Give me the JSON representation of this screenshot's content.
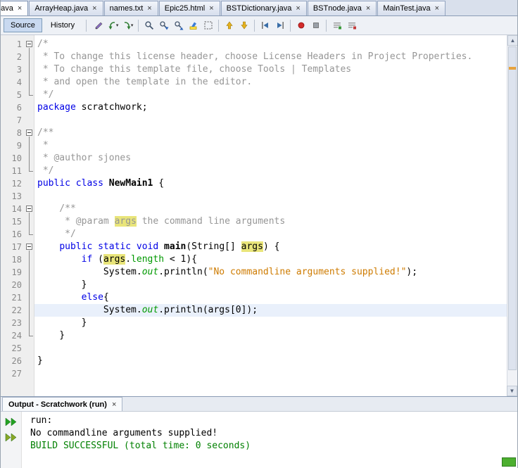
{
  "tab_bar": {
    "tabs": [
      {
        "label": "...ava",
        "active": true,
        "partial": true
      },
      {
        "label": "ArrayHeap.java"
      },
      {
        "label": "names.txt"
      },
      {
        "label": "Epic25.html"
      },
      {
        "label": "BSTDictionary.java"
      },
      {
        "label": "BSTnode.java"
      },
      {
        "label": "MainTest.java"
      }
    ],
    "close_glyph": "×"
  },
  "toolbar": {
    "source_label": "Source",
    "history_label": "History",
    "icon_groups": [
      [
        {
          "name": "last-edit-location"
        },
        {
          "name": "back",
          "dropdown": true
        },
        {
          "name": "forward",
          "dropdown": true
        }
      ],
      [
        {
          "name": "find-selection"
        },
        {
          "name": "find-next-occurrence"
        },
        {
          "name": "find-previous-occurrence"
        },
        {
          "name": "toggle-highlight-search"
        },
        {
          "name": "select-in-projects"
        }
      ],
      [
        {
          "name": "previous-bookmark"
        },
        {
          "name": "next-bookmark"
        }
      ],
      [
        {
          "name": "shift-line-left"
        },
        {
          "name": "shift-line-right"
        }
      ],
      [
        {
          "name": "start-macro-recording"
        },
        {
          "name": "stop-macro-recording"
        }
      ],
      [
        {
          "name": "comment"
        },
        {
          "name": "uncomment"
        }
      ]
    ]
  },
  "editor": {
    "colors": {
      "keyword": "#0000e6",
      "comment": "#969696",
      "string": "#ce7b00",
      "field": "#009900",
      "occurrence_bg": "#e9e57a",
      "current_line_bg": "#e9f0fb"
    },
    "lines": [
      {
        "n": 1,
        "fold": "start",
        "segs": [
          {
            "t": "/*",
            "c": "cm"
          }
        ]
      },
      {
        "n": 2,
        "fold": "mid",
        "segs": [
          {
            "t": " * To change this license header, choose License Headers in Project Properties.",
            "c": "cm"
          }
        ]
      },
      {
        "n": 3,
        "fold": "mid",
        "segs": [
          {
            "t": " * To change this template file, choose Tools | Templates",
            "c": "cm"
          }
        ]
      },
      {
        "n": 4,
        "fold": "mid",
        "segs": [
          {
            "t": " * and open the template in the editor.",
            "c": "cm"
          }
        ]
      },
      {
        "n": 5,
        "fold": "end",
        "segs": [
          {
            "t": " */",
            "c": "cm"
          }
        ]
      },
      {
        "n": 6,
        "fold": "",
        "segs": [
          {
            "t": "package",
            "c": "kw"
          },
          {
            "t": " scratchwork;",
            "c": "pl"
          }
        ]
      },
      {
        "n": 7,
        "fold": "",
        "segs": []
      },
      {
        "n": 8,
        "fold": "start",
        "segs": [
          {
            "t": "/**",
            "c": "cm"
          }
        ]
      },
      {
        "n": 9,
        "fold": "mid",
        "segs": [
          {
            "t": " *",
            "c": "cm"
          }
        ]
      },
      {
        "n": 10,
        "fold": "mid",
        "segs": [
          {
            "t": " * @author sjones",
            "c": "cm"
          }
        ]
      },
      {
        "n": 11,
        "fold": "end",
        "segs": [
          {
            "t": " */",
            "c": "cm"
          }
        ]
      },
      {
        "n": 12,
        "fold": "",
        "segs": [
          {
            "t": "public",
            "c": "kw"
          },
          {
            "t": " ",
            "c": "pl"
          },
          {
            "t": "class",
            "c": "kw"
          },
          {
            "t": " ",
            "c": "pl"
          },
          {
            "t": "NewMain1",
            "c": "cl"
          },
          {
            "t": " {",
            "c": "pl"
          }
        ]
      },
      {
        "n": 13,
        "fold": "",
        "segs": []
      },
      {
        "n": 14,
        "fold": "start",
        "segs": [
          {
            "t": "    /**",
            "c": "cm"
          }
        ]
      },
      {
        "n": 15,
        "fold": "mid",
        "segs": [
          {
            "t": "     * @param ",
            "c": "cm"
          },
          {
            "t": "args",
            "c": "cmhl"
          },
          {
            "t": " the command line arguments",
            "c": "cm"
          }
        ]
      },
      {
        "n": 16,
        "fold": "end",
        "segs": [
          {
            "t": "     */",
            "c": "cm"
          }
        ]
      },
      {
        "n": 17,
        "fold": "start",
        "segs": [
          {
            "t": "    ",
            "c": "pl"
          },
          {
            "t": "public",
            "c": "kw"
          },
          {
            "t": " ",
            "c": "pl"
          },
          {
            "t": "static",
            "c": "kw"
          },
          {
            "t": " ",
            "c": "pl"
          },
          {
            "t": "void",
            "c": "kw"
          },
          {
            "t": " ",
            "c": "pl"
          },
          {
            "t": "main",
            "c": "cl"
          },
          {
            "t": "(String[] ",
            "c": "pl"
          },
          {
            "t": "args",
            "c": "hl"
          },
          {
            "t": ") {",
            "c": "pl"
          }
        ]
      },
      {
        "n": 18,
        "fold": "mid",
        "segs": [
          {
            "t": "        ",
            "c": "pl"
          },
          {
            "t": "if",
            "c": "kw"
          },
          {
            "t": " (",
            "c": "pl"
          },
          {
            "t": "args",
            "c": "hl"
          },
          {
            "t": ".",
            "c": "pl"
          },
          {
            "t": "length",
            "c": "fld"
          },
          {
            "t": " < 1){",
            "c": "pl"
          }
        ]
      },
      {
        "n": 19,
        "fold": "mid",
        "segs": [
          {
            "t": "            System.",
            "c": "pl"
          },
          {
            "t": "out",
            "c": "sfld"
          },
          {
            "t": ".println(",
            "c": "pl"
          },
          {
            "t": "\"No commandline arguments supplied!\"",
            "c": "str"
          },
          {
            "t": ");",
            "c": "pl"
          }
        ]
      },
      {
        "n": 20,
        "fold": "mid",
        "segs": [
          {
            "t": "        }",
            "c": "pl"
          }
        ]
      },
      {
        "n": 21,
        "fold": "mid",
        "segs": [
          {
            "t": "        ",
            "c": "pl"
          },
          {
            "t": "else",
            "c": "kw"
          },
          {
            "t": "{",
            "c": "pl"
          }
        ]
      },
      {
        "n": 22,
        "fold": "mid",
        "current": true,
        "segs": [
          {
            "t": "            System.",
            "c": "pl"
          },
          {
            "t": "out",
            "c": "sfld"
          },
          {
            "t": ".println(args[0]);",
            "c": "pl"
          }
        ]
      },
      {
        "n": 23,
        "fold": "mid",
        "segs": [
          {
            "t": "        }",
            "c": "pl"
          }
        ]
      },
      {
        "n": 24,
        "fold": "end",
        "segs": [
          {
            "t": "    }",
            "c": "pl"
          }
        ]
      },
      {
        "n": 25,
        "fold": "",
        "segs": []
      },
      {
        "n": 26,
        "fold": "",
        "segs": [
          {
            "t": "}",
            "c": "pl"
          }
        ]
      },
      {
        "n": 27,
        "fold": "",
        "segs": []
      }
    ]
  },
  "output": {
    "tab_label": "Output - Scratchwork (run)",
    "close_glyph": "×",
    "buttons": [
      {
        "name": "rerun",
        "color": "#23a123"
      },
      {
        "name": "rerun-with-different-parameters",
        "color": "#8aa625"
      }
    ],
    "lines": [
      {
        "text": "run:",
        "color": "#000000"
      },
      {
        "text": "No commandline arguments supplied!",
        "color": "#000000"
      },
      {
        "text": "BUILD SUCCESSFUL (total time: 0 seconds)",
        "color": "#008000"
      }
    ]
  }
}
